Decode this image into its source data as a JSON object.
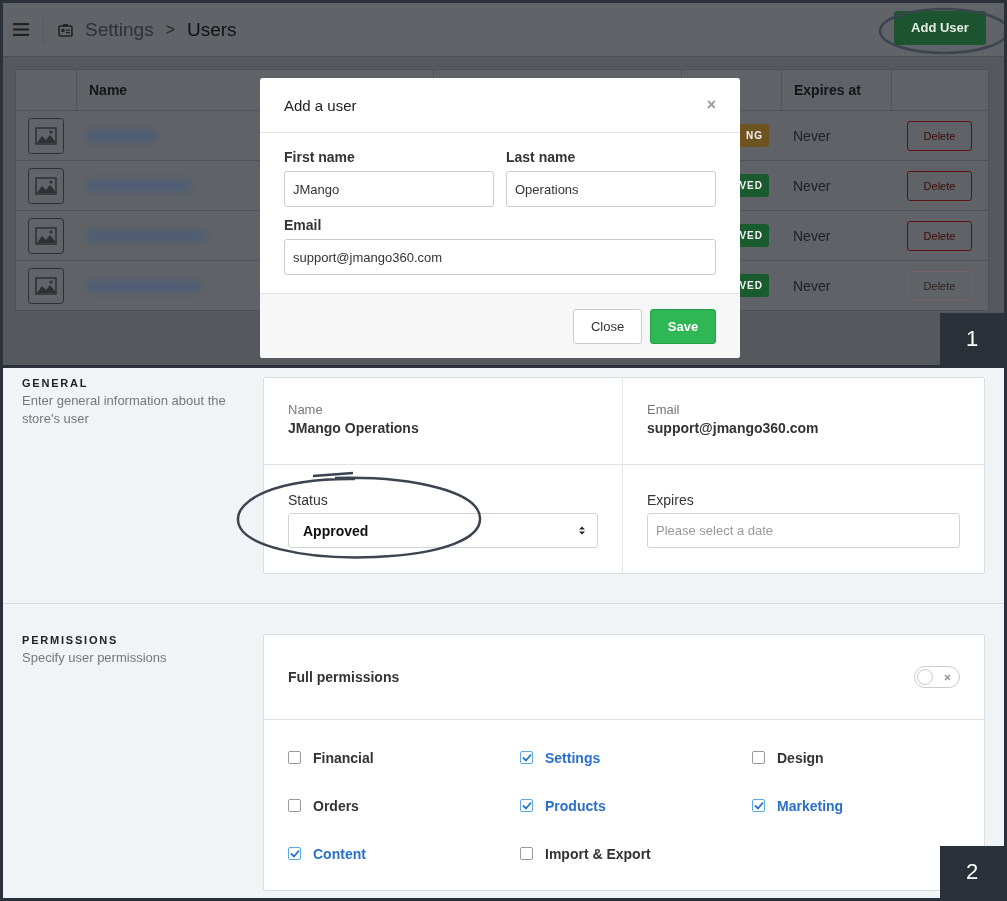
{
  "header": {
    "breadcrumb": [
      "Settings",
      "Users"
    ],
    "separator": ">",
    "add_button": "Add User"
  },
  "table": {
    "columns": [
      "Name",
      "Expires at"
    ],
    "rows": [
      {
        "status": {
          "label": "NG",
          "kind": "pending"
        },
        "expires": "Never",
        "action": "Delete",
        "disabled": false
      },
      {
        "status": {
          "label": "VED",
          "kind": "approved"
        },
        "expires": "Never",
        "action": "Delete",
        "disabled": false
      },
      {
        "status": {
          "label": "VED",
          "kind": "approved"
        },
        "expires": "Never",
        "action": "Delete",
        "disabled": false
      },
      {
        "status": {
          "label": "VED",
          "kind": "approved"
        },
        "expires": "Never",
        "action": "Delete",
        "disabled": true
      }
    ]
  },
  "modal": {
    "title": "Add a user",
    "close": "×",
    "fields": [
      {
        "label": "First name",
        "value": "JMango"
      },
      {
        "label": "Last name",
        "value": "Operations"
      },
      {
        "label": "Email",
        "value": "support@jmango360.com"
      }
    ],
    "buttons": [
      {
        "label": "Close",
        "kind": "default"
      },
      {
        "label": "Save",
        "kind": "primary"
      }
    ]
  },
  "steps": [
    "1",
    "2"
  ],
  "general": {
    "title": "GENERAL",
    "description": "Enter general information about the store's user",
    "name_label": "Name",
    "name": "JMango Operations",
    "email_label": "Email",
    "email": "support@jmango360.com",
    "status_label": "Status",
    "status": "Approved",
    "expires_label": "Expires",
    "expires_placeholder": "Please select a date"
  },
  "permissions": {
    "title": "PERMISSIONS",
    "description": "Specify user permissions",
    "full_label": "Full permissions",
    "full_on": false,
    "items": [
      {
        "label": "Financial",
        "checked": false
      },
      {
        "label": "Settings",
        "checked": true
      },
      {
        "label": "Design",
        "checked": false
      },
      {
        "label": "Orders",
        "checked": false
      },
      {
        "label": "Products",
        "checked": true
      },
      {
        "label": "Marketing",
        "checked": true
      },
      {
        "label": "Content",
        "checked": true
      },
      {
        "label": "Import & Export",
        "checked": false
      }
    ]
  }
}
